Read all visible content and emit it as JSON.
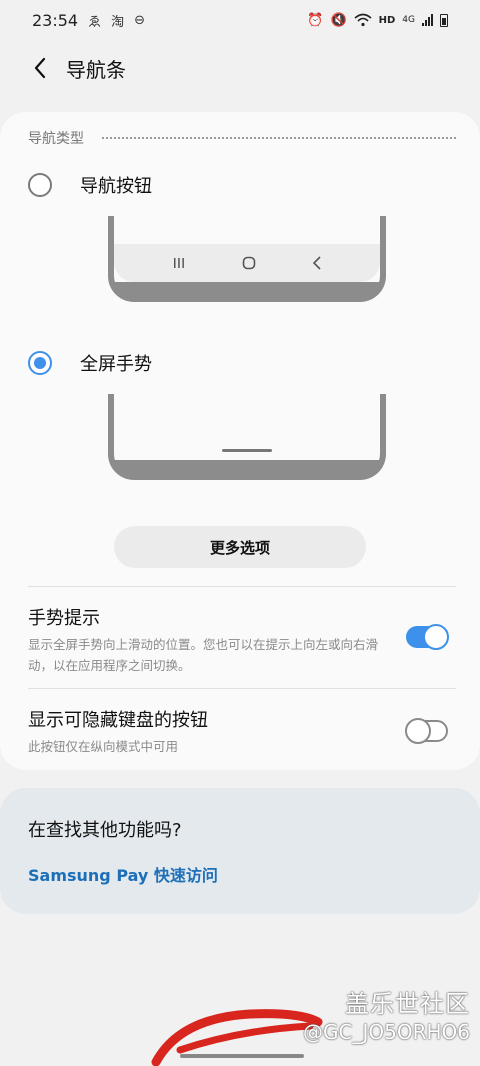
{
  "status_bar": {
    "time": "23:54",
    "network": "HD",
    "network_gen": "4G"
  },
  "header": {
    "title": "导航条"
  },
  "nav_type": {
    "section_label": "导航类型",
    "options": [
      {
        "label": "导航按钮",
        "selected": false
      },
      {
        "label": "全屏手势",
        "selected": true
      }
    ]
  },
  "more_options_label": "更多选项",
  "settings": [
    {
      "title": "手势提示",
      "description": "显示全屏手势向上滑动的位置。您也可以在提示上向左或向右滑动，以在应用程序之间切换。",
      "enabled": true
    },
    {
      "title": "显示可隐藏键盘的按钮",
      "description": "此按钮仅在纵向模式中可用",
      "enabled": false
    }
  ],
  "suggestion": {
    "question": "在查找其他功能吗?",
    "link": "Samsung Pay 快速访问"
  },
  "watermark": {
    "logo": "盖乐世社区",
    "user": "@GC_JO5ORHO6"
  },
  "colors": {
    "accent": "#3e91ea",
    "link": "#1d6fb8",
    "background": "#f1f1f1",
    "card": "#fafafa",
    "suggest_card": "#e4e9ee"
  }
}
